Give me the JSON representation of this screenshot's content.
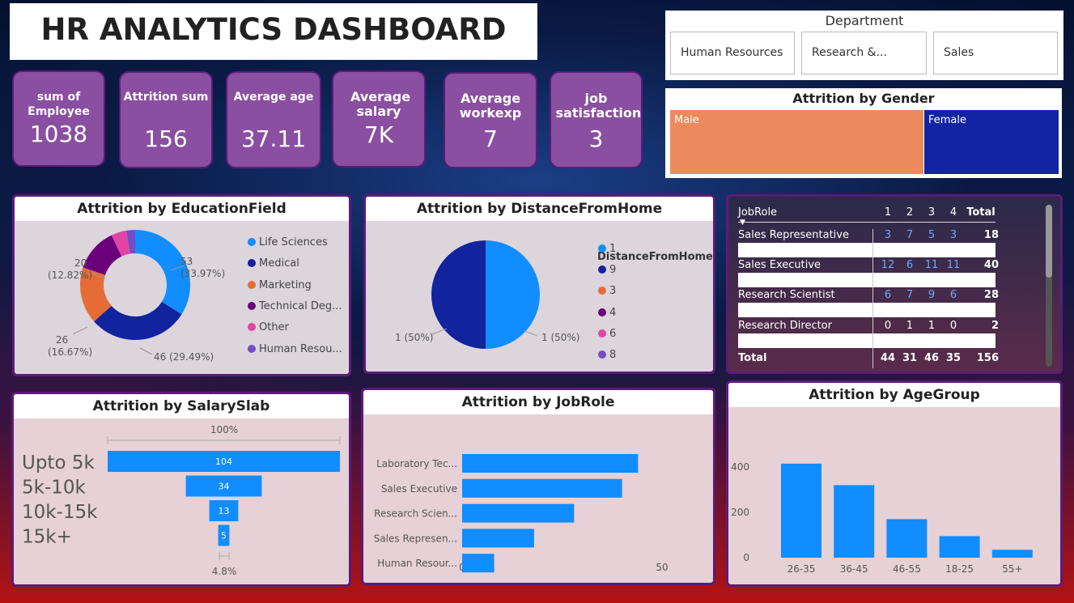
{
  "title": "HR ANALYTICS DASHBOARD",
  "kpis": [
    {
      "label": "sum of Employee",
      "value": "1038"
    },
    {
      "label": "Attrition sum",
      "value": "156"
    },
    {
      "label": "Average age",
      "value": "37.11"
    },
    {
      "label": "Average salary",
      "value": "7K"
    },
    {
      "label": "Average workexp",
      "value": "7"
    },
    {
      "label": "job satisfaction",
      "value": "3"
    }
  ],
  "department": {
    "header": "Department",
    "options": [
      "Human Resources",
      "Research &...",
      "Sales"
    ]
  },
  "gender": {
    "title": "Attrition by Gender",
    "male_label": "Male",
    "female_label": "Female",
    "colors": {
      "male": "#ec8a5d",
      "female": "#1224a3"
    }
  },
  "education": {
    "title": "Attrition by EducationField",
    "legend": [
      "Life Sciences",
      "Medical",
      "Marketing",
      "Technical Deg...",
      "Other",
      "Human Resou..."
    ],
    "colors": [
      "#118dff",
      "#12239e",
      "#e66c37",
      "#6b007b",
      "#e044a7",
      "#744ec2"
    ],
    "labels": [
      {
        "v": "53",
        "p": "(33.97%)"
      },
      {
        "v": "46 (29.49%)",
        "p": ""
      },
      {
        "v": "26",
        "p": "(16.67%)"
      },
      {
        "v": "20",
        "p": "(12.82%)"
      }
    ]
  },
  "distance": {
    "title": "Attrition by DistanceFromHome",
    "legend_title": "DistanceFromHome",
    "legend": [
      "1",
      "9",
      "3",
      "4",
      "6",
      "8"
    ],
    "colors": [
      "#118dff",
      "#12239e",
      "#e66c37",
      "#6b007b",
      "#e044a7",
      "#744ec2"
    ],
    "left_label": "1 (50%)",
    "right_label": "1 (50%)"
  },
  "matrix": {
    "header": "JobRole",
    "cols": [
      "1",
      "2",
      "3",
      "4",
      "Total"
    ],
    "rows": [
      {
        "role": "Sales Representative",
        "vals": [
          "3",
          "7",
          "5",
          "3"
        ],
        "total": "18"
      },
      {
        "role": "Sales Executive",
        "vals": [
          "12",
          "6",
          "11",
          "11"
        ],
        "total": "40"
      },
      {
        "role": "Research Scientist",
        "vals": [
          "6",
          "7",
          "9",
          "6"
        ],
        "total": "28"
      },
      {
        "role": "Research Director",
        "vals": [
          "0",
          "1",
          "1",
          "0"
        ],
        "total": "2"
      }
    ],
    "total_row": {
      "role": "Total",
      "vals": [
        "44",
        "31",
        "46",
        "35"
      ],
      "total": "156"
    }
  },
  "salary": {
    "title": "Attrition by SalarySlab",
    "top_pct": "100%",
    "bottom_pct": "4.8%",
    "rows": [
      {
        "label": "Upto 5k",
        "value": "104"
      },
      {
        "label": "5k-10k",
        "value": "34"
      },
      {
        "label": "10k-15k",
        "value": "13"
      },
      {
        "label": "15k+",
        "value": "5"
      }
    ]
  },
  "jobrole": {
    "title": "Attrition by JobRole",
    "axis": [
      "0",
      "50"
    ]
  },
  "agegroup": {
    "title": "Attrition by AgeGroup"
  },
  "chart_data": [
    {
      "type": "pie",
      "title": "Attrition by EducationField",
      "categories": [
        "Life Sciences",
        "Medical",
        "Marketing",
        "Technical Deg...",
        "Other",
        "Human Resou..."
      ],
      "values": [
        53,
        46,
        26,
        20,
        7,
        4
      ]
    },
    {
      "type": "pie",
      "title": "Attrition by DistanceFromHome",
      "categories": [
        "1",
        "9"
      ],
      "values": [
        1,
        1
      ]
    },
    {
      "type": "bar",
      "title": "Attrition by SalarySlab",
      "categories": [
        "Upto 5k",
        "5k-10k",
        "10k-15k",
        "15k+"
      ],
      "values": [
        104,
        34,
        13,
        5
      ]
    },
    {
      "type": "bar",
      "title": "Attrition by JobRole",
      "categories": [
        "Laboratory Tec...",
        "Sales Executive",
        "Research Scien...",
        "Sales Represen...",
        "Human Resour..."
      ],
      "values": [
        44,
        40,
        28,
        18,
        8
      ],
      "xlim": [
        0,
        60
      ]
    },
    {
      "type": "bar",
      "title": "Attrition by AgeGroup",
      "categories": [
        "26-35",
        "36-45",
        "46-55",
        "18-25",
        "55+"
      ],
      "values": [
        415,
        320,
        170,
        95,
        35
      ],
      "ylim": [
        0,
        480
      ],
      "yticks": [
        "0",
        "200",
        "400"
      ]
    }
  ]
}
